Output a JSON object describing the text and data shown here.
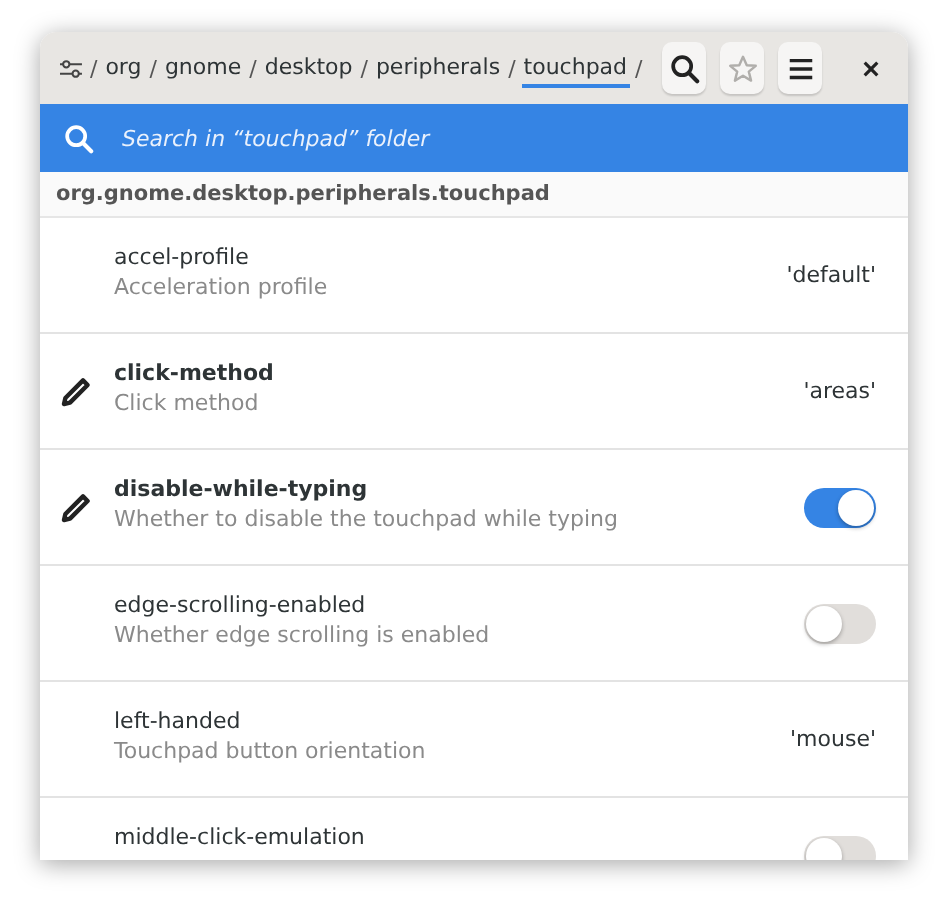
{
  "breadcrumb": [
    {
      "label": "org",
      "selected": false
    },
    {
      "label": "gnome",
      "selected": false
    },
    {
      "label": "desktop",
      "selected": false
    },
    {
      "label": "peripherals",
      "selected": false
    },
    {
      "label": "touchpad",
      "selected": true
    }
  ],
  "separator": "/",
  "toolbar": {
    "bookmark_disabled": true
  },
  "search": {
    "placeholder": "Search in “touchpad” folder"
  },
  "schema": "org.gnome.desktop.peripherals.touchpad",
  "keys": [
    {
      "name": "accel-profile",
      "summary": "Acceleration profile",
      "modified": false,
      "kind": "value",
      "value": "'default'"
    },
    {
      "name": "click-method",
      "summary": "Click method",
      "modified": true,
      "kind": "value",
      "value": "'areas'"
    },
    {
      "name": "disable-while-typing",
      "summary": "Whether to disable the touchpad while typing",
      "modified": true,
      "kind": "toggle",
      "on": true
    },
    {
      "name": "edge-scrolling-enabled",
      "summary": "Whether edge scrolling is enabled",
      "modified": false,
      "kind": "toggle",
      "on": false
    },
    {
      "name": "left-handed",
      "summary": "Touchpad button orientation",
      "modified": false,
      "kind": "value",
      "value": "'mouse'"
    },
    {
      "name": "middle-click-emulation",
      "modified": false,
      "kind": "toggle",
      "on": false
    }
  ]
}
